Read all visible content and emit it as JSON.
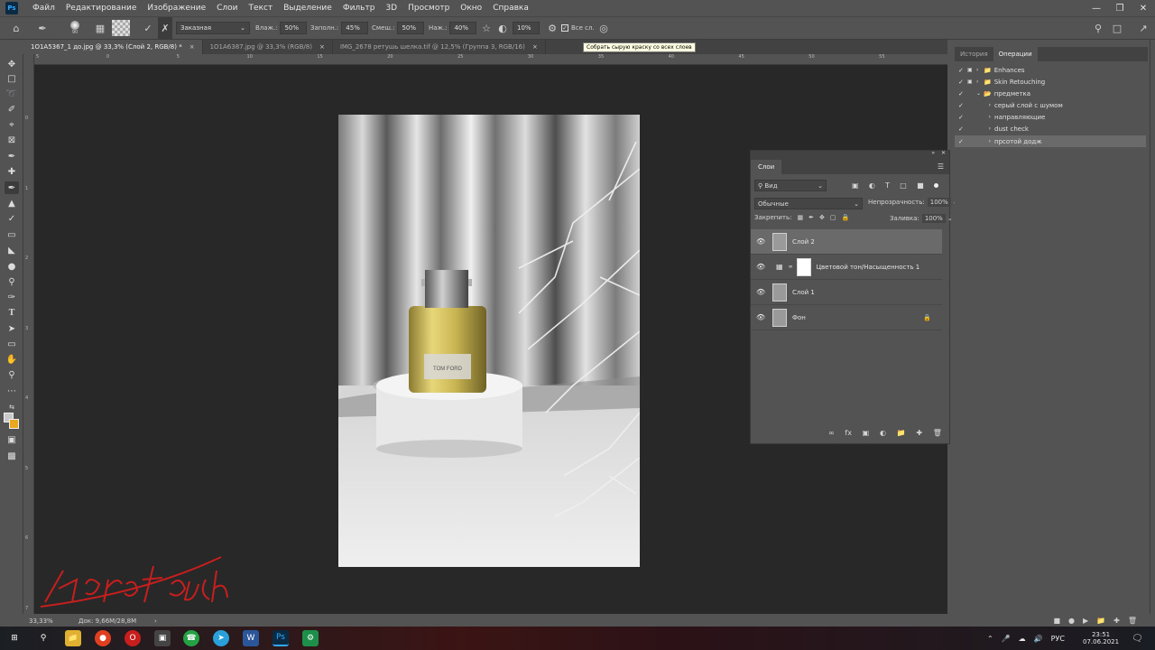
{
  "menubar": {
    "logo": "Ps",
    "items": [
      "Файл",
      "Редактирование",
      "Изображение",
      "Слои",
      "Текст",
      "Выделение",
      "Фильтр",
      "3D",
      "Просмотр",
      "Окно",
      "Справка"
    ]
  },
  "options": {
    "brush_size": "90",
    "mode": "Заказная",
    "wet_label": "Влаж.:",
    "wet_value": "50%",
    "load_label": "Заполн.:",
    "load_value": "45%",
    "mix_label": "Смеш.:",
    "mix_value": "50%",
    "flow_label": "Наж.:",
    "flow_value": "40%",
    "angle_value": "10%",
    "sample_all_label": "Все сл.",
    "tooltip": "Собрать сырую краску со всех слоев"
  },
  "tabs": [
    {
      "label": "1O1A5367_1 до.jpg @ 33,3% (Слой 2, RGB/8) *",
      "close": "×"
    },
    {
      "label": "1O1A6387.jpg @ 33,3% (RGB/8)",
      "close": "×"
    },
    {
      "label": "IMG_2678 ретушь шелка.tif @ 12,5% (Группа 3, RGB/16)",
      "close": "×"
    }
  ],
  "ruler": {
    "top_ticks": [
      "5",
      "0",
      "5",
      "10",
      "15",
      "20",
      "25",
      "30",
      "35",
      "40",
      "45",
      "50",
      "55"
    ],
    "left_ticks": [
      "0",
      "1",
      "2",
      "3",
      "4",
      "5",
      "6",
      "7"
    ]
  },
  "status": {
    "zoom": "33,33%",
    "doc": "Док: 9,66M/28,8M",
    "arrow": "›"
  },
  "watermark": "kara.touch",
  "canvas_image": {
    "label": "TOM FORD"
  },
  "layers_panel": {
    "title": "Слои",
    "filter_label": "Вид",
    "blend_mode": "Обычные",
    "opacity_label": "Непрозрачность:",
    "opacity_value": "100%",
    "lock_label": "Закрепить:",
    "fill_label": "Заливка:",
    "fill_value": "100%",
    "layers": [
      {
        "name": "Слой 2"
      },
      {
        "name": "Цветовой тон/Насыщенность 1"
      },
      {
        "name": "Слой 1"
      },
      {
        "name": "Фон"
      }
    ]
  },
  "right_panel": {
    "tabs": [
      "История",
      "Операции"
    ],
    "actions": [
      {
        "label": "Enhances"
      },
      {
        "label": "Skin Retouching"
      },
      {
        "label": "предметка"
      },
      {
        "label": "серый слой с шумом"
      },
      {
        "label": "направляющие"
      },
      {
        "label": "dust check"
      },
      {
        "label": "прсотой додж"
      }
    ]
  },
  "taskbar": {
    "lang": "РУС",
    "time": "23:51",
    "date": "07.06.2021"
  },
  "colors": {
    "accent": "#31a8ff",
    "foreground_color": "#c9c9c9",
    "background_color": "#e8a820",
    "ps_blue": "#0b2a43"
  }
}
